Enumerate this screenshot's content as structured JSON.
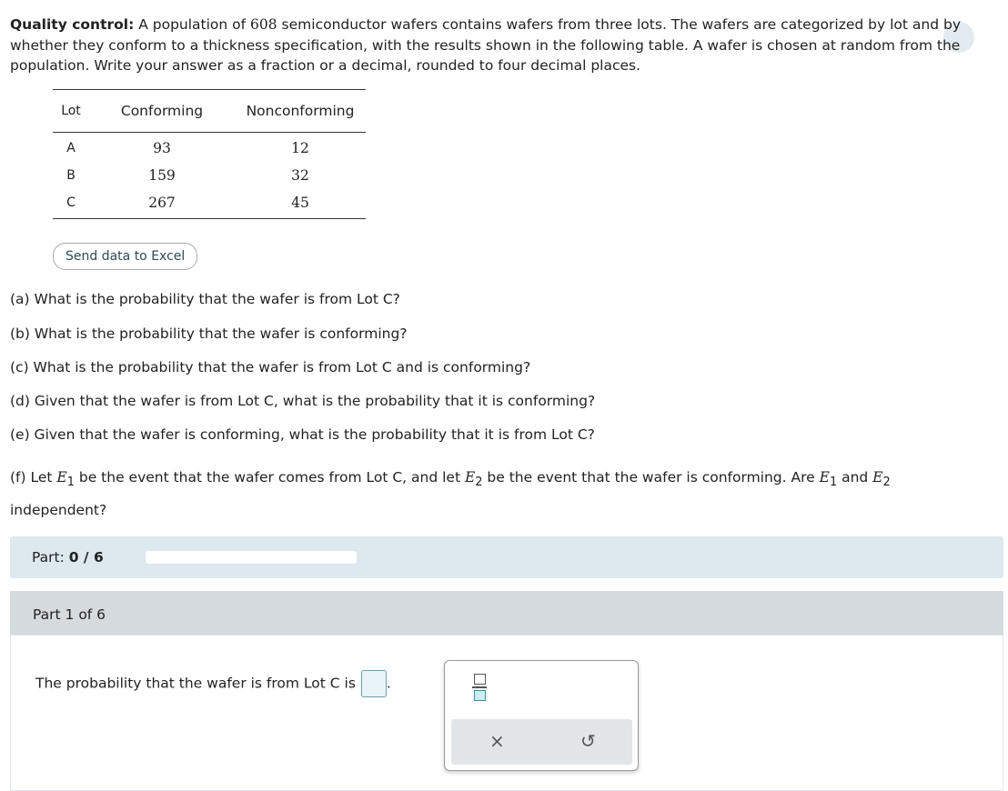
{
  "intro": {
    "lead": "Quality control:",
    "pre": " A population of ",
    "n": "608",
    "post": " semiconductor wafers contains wafers from three lots. The wafers are categorized by lot and by whether they conform to a thickness specification, with the results shown in the following table. A wafer is chosen at random from the population. Write your answer as a fraction or a decimal, rounded to four decimal places."
  },
  "table": {
    "headers": [
      "Lot",
      "Conforming",
      "Nonconforming"
    ],
    "rows": [
      [
        "A",
        "93",
        "12"
      ],
      [
        "B",
        "159",
        "32"
      ],
      [
        "C",
        "267",
        "45"
      ]
    ]
  },
  "excel_button": "Send data to Excel",
  "questions": {
    "a": "(a) What is the probability that the wafer is from Lot C?",
    "b": "(b) What is the probability that the wafer is conforming?",
    "c": "(c) What is the probability that the wafer is from Lot C and is conforming?",
    "d": "(d) Given that the wafer is from Lot C, what is the probability that it is conforming?",
    "e": "(e) Given that the wafer is conforming, what is the probability that it is from Lot C?",
    "f1": "(f) Let ",
    "E": "E",
    "s1": "1",
    "f2": " be the event that the wafer comes from Lot C, and let ",
    "s2": "2",
    "f3": " be the event that the wafer is conforming. Are ",
    "f4": " and ",
    "f5": "independent?"
  },
  "progress": {
    "label": "Part: ",
    "value": "0 / 6",
    "fraction": 0
  },
  "part": {
    "title": "Part 1 of 6",
    "prompt": "The probability that the wafer is from Lot C is",
    "period": "."
  },
  "keypad": {
    "clear": "×",
    "undo": "↺"
  }
}
